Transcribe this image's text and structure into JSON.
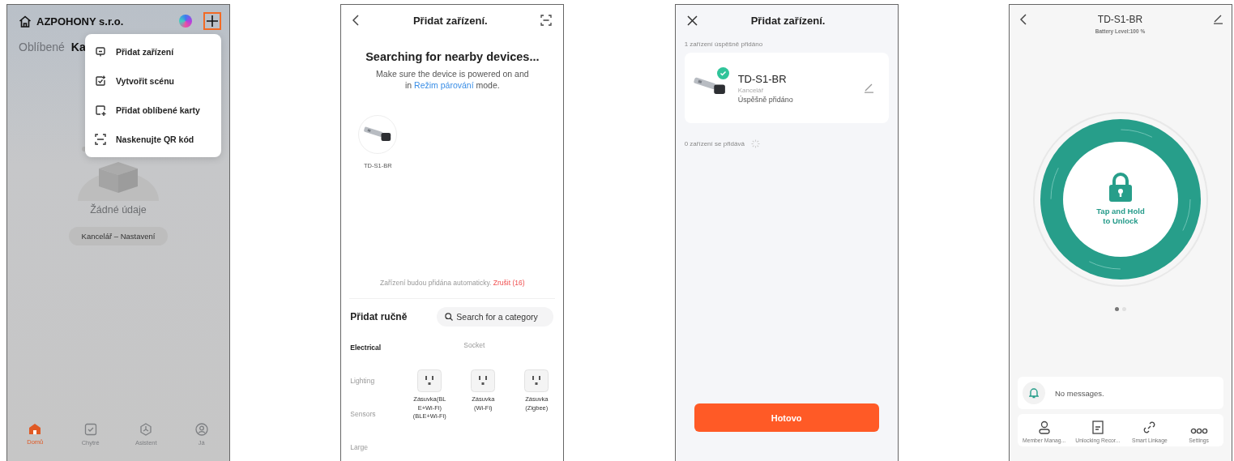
{
  "home_screen": {
    "title": "AZPOHONY s.r.o.",
    "tabs": [
      {
        "label": "Oblíbené",
        "selected": false
      },
      {
        "label": "Ka",
        "selected": true
      }
    ],
    "menu": [
      {
        "kind": "device",
        "label": "Přidat zařízení"
      },
      {
        "kind": "scene",
        "label": "Vytvořit scénu"
      },
      {
        "kind": "card",
        "label": "Přidat oblíbené karty"
      },
      {
        "kind": "scan",
        "label": "Naskenujte QR kód"
      }
    ],
    "empty_message": "Žádné údaje",
    "empty_button": "Kancelář – Nastavení",
    "nav": [
      {
        "kind": "home",
        "label": "Domů",
        "selected": true
      },
      {
        "kind": "smart",
        "label": "Chytré",
        "selected": false
      },
      {
        "kind": "assistant",
        "label": "Asistent",
        "selected": false
      },
      {
        "kind": "me",
        "label": "Já",
        "selected": false
      }
    ]
  },
  "search_screen": {
    "title": "Přidat zařízení.",
    "heading": "Searching for nearby devices...",
    "hint": "Make sure the device is powered on and in",
    "hint_link": "Režim párování",
    "hint_end": "mode.",
    "found": [
      {
        "name": "TD-S1-BR"
      }
    ],
    "auto_note": "Zařízení budou přidána automaticky.",
    "cancel_link": "Zrušit (16)",
    "manual_title": "Přidat ručně",
    "search": {
      "placeholder": "Search for a category"
    },
    "categories": [
      {
        "label": "Electrical",
        "selected": true
      },
      {
        "label": "Lighting",
        "selected": false
      },
      {
        "label": "Sensors",
        "selected": false
      },
      {
        "label": "Large",
        "selected": false
      }
    ],
    "section": "Socket",
    "products": [
      {
        "label": "Zásuvka(BLE+Wi-Fi)(BLE+Wi-Fi)"
      },
      {
        "label": "Zásuvka (Wi-Fi)"
      },
      {
        "label": "Zásuvka (Zigbee)"
      }
    ]
  },
  "result_screen": {
    "title": "Přidat zařízení.",
    "added_label": "1 zařízení úspěšně přidáno",
    "devices": [
      {
        "name": "TD-S1-BR",
        "room": "Kancelář",
        "status": "Úspěšně přidáno"
      }
    ],
    "pending_label": "0 zařízení se přidává",
    "button": "Hotovo"
  },
  "lock_screen": {
    "title": "TD-S1-BR",
    "battery": "Battery Level:100 %",
    "unlock_label": "Tap and Hold to Unlock",
    "pages": [
      {
        "selected": true
      },
      {
        "selected": false
      }
    ],
    "messages": "No messages.",
    "actions": [
      {
        "kind": "member",
        "label": "Member Manag..."
      },
      {
        "kind": "records",
        "label": "Unlocking Recor..."
      },
      {
        "kind": "link",
        "label": "Smart Linkage"
      },
      {
        "kind": "settings",
        "label": "Settings"
      }
    ]
  }
}
